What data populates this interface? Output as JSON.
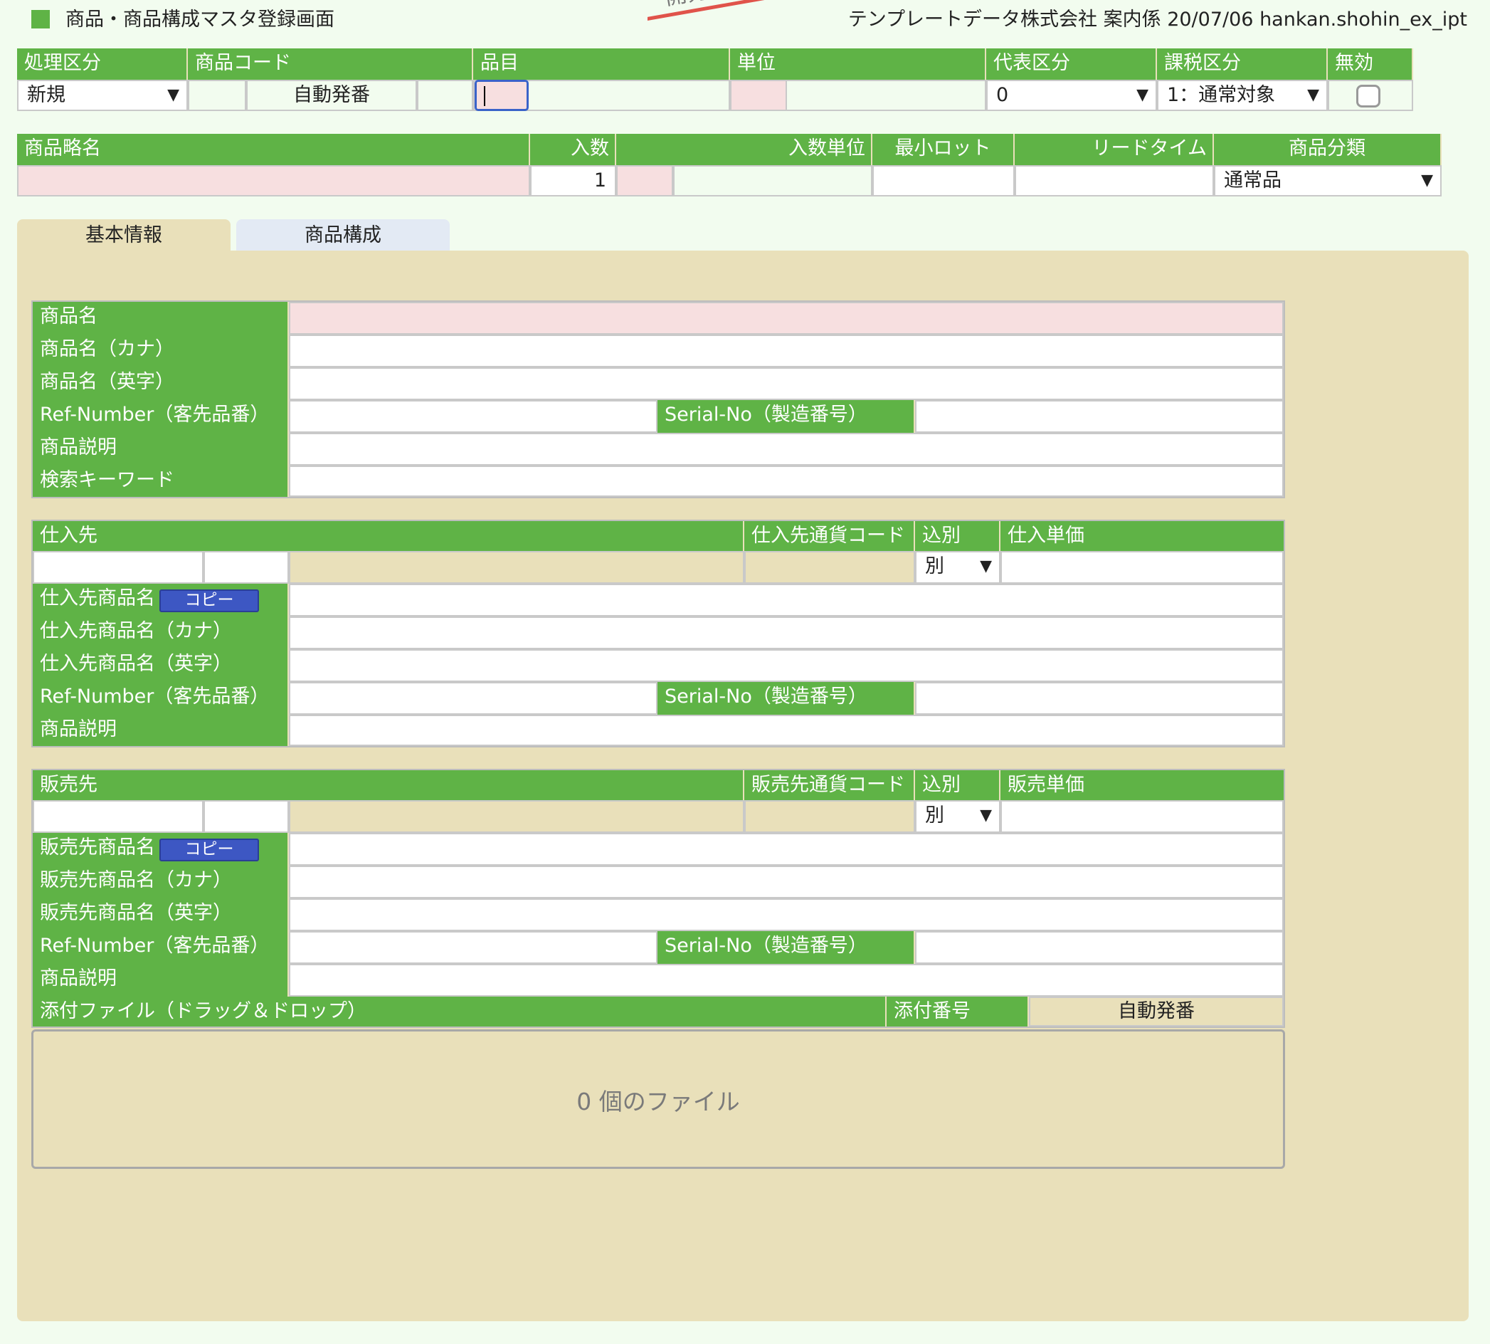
{
  "header": {
    "title": "商品・商品構成マスタ登録画面",
    "company": "テンプレートデータ株式会社",
    "user": "案内係",
    "date": "20/07/06",
    "program": "hankan.shohin_ex_ipt",
    "stamp_text": "開発",
    "accent_color": "#5fb346"
  },
  "top_row1": {
    "labels": {
      "shori": "処理区分",
      "shohin_code": "商品コード",
      "hinmoku": "品目",
      "tani": "単位",
      "daihyo": "代表区分",
      "kazei": "課税区分",
      "muko": "無効"
    },
    "shori_value": "新規",
    "shohin_code_value": "自動発番",
    "daihyo_value": "0",
    "kazei_value": "1：通常対象"
  },
  "top_row2": {
    "labels": {
      "ryakumei": "商品略名",
      "irisu": "入数",
      "irisu_tani": "入数単位",
      "min_lot": "最小ロット",
      "lead_time": "リードタイム",
      "bunrui": "商品分類"
    },
    "irisu_value": "1",
    "bunrui_value": "通常品"
  },
  "tabs": {
    "basic": "基本情報",
    "composition": "商品構成"
  },
  "basic": {
    "name": "商品名",
    "name_kana": "商品名（カナ）",
    "name_eng": "商品名（英字）",
    "ref_number": "Ref-Number（客先品番）",
    "serial_no": "Serial-No（製造番号）",
    "description": "商品説明",
    "keyword": "検索キーワード"
  },
  "supplier": {
    "header": "仕入先",
    "currency": "仕入先通貨コード",
    "tax": "込別",
    "price": "仕入単価",
    "tax_value": "別",
    "name": "仕入先商品名",
    "copy": "コピー",
    "name_kana": "仕入先商品名（カナ）",
    "name_eng": "仕入先商品名（英字）",
    "ref_number": "Ref-Number（客先品番）",
    "serial_no": "Serial-No（製造番号）",
    "description": "商品説明"
  },
  "customer": {
    "header": "販売先",
    "currency": "販売先通貨コード",
    "tax": "込別",
    "price": "販売単価",
    "tax_value": "別",
    "name": "販売先商品名",
    "copy": "コピー",
    "name_kana": "販売先商品名（カナ）",
    "name_eng": "販売先商品名（英字）",
    "ref_number": "Ref-Number（客先品番）",
    "serial_no": "Serial-No（製造番号）",
    "description": "商品説明"
  },
  "attachment": {
    "label": "添付ファイル（ドラッグ＆ドロップ）",
    "number_label": "添付番号",
    "number_value": "自動発番",
    "dropzone": "0 個のファイル"
  }
}
